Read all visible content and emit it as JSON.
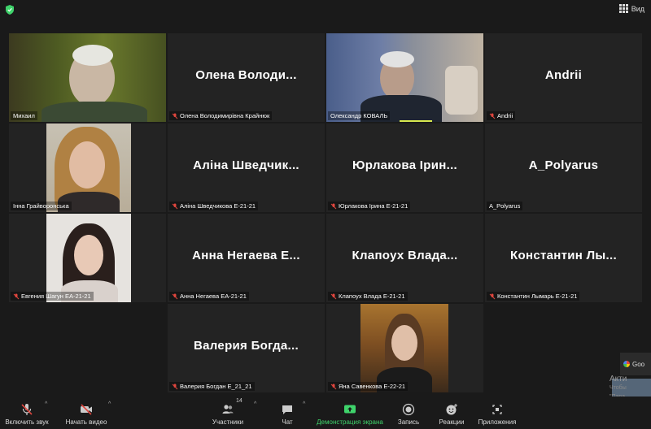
{
  "header": {
    "view_label": "Вид"
  },
  "tiles": [
    {
      "big": "",
      "label": "Михаил",
      "muted": false
    },
    {
      "big": "Олена Володи...",
      "label": "Олена Володимирівна Крайнюк",
      "muted": true
    },
    {
      "big": "",
      "label": "Олександр КОВАЛЬ",
      "muted": false
    },
    {
      "big": "Andrii",
      "label": "Andrii",
      "muted": true
    },
    {
      "big": "",
      "label": "Інна Грайворонська",
      "muted": false
    },
    {
      "big": "Аліна Шведчик...",
      "label": "Аліна Шведчикова Е-21-21",
      "muted": true
    },
    {
      "big": "Юрлакова Ірин...",
      "label": "Юрлакова Ірина Е-21-21",
      "muted": true
    },
    {
      "big": "A_Polyarus",
      "label": "A_Polyarus",
      "muted": false
    },
    {
      "big": "",
      "label": "Евгения Шагун ЕА-21-21",
      "muted": true
    },
    {
      "big": "Анна Негаева Е...",
      "label": "Анна Негаева ЕА-21-21",
      "muted": true
    },
    {
      "big": "Клапоух Влада...",
      "label": "Клапоух Влада Е-21-21",
      "muted": true
    },
    {
      "big": "Константин Лы...",
      "label": "Константин Лымарь Е-21-21",
      "muted": true
    },
    {
      "big": "Валерия Богда...",
      "label": "Валерия Богдан Е_21_21",
      "muted": true
    },
    {
      "big": "",
      "label": "Яна Савенкова Е-22-21",
      "muted": true
    }
  ],
  "toolbar": {
    "mute_label": "Включить звук",
    "video_label": "Начать видео",
    "participants_label": "Участники",
    "participants_count": "14",
    "chat_label": "Чат",
    "share_label": "Демонстрация экрана",
    "record_label": "Запись",
    "reactions_label": "Реакции",
    "apps_label": "Приложения"
  },
  "side": {
    "chip_label": "Goo",
    "activate_title": "Акти",
    "activate_line1": "Чтобы",
    "activate_line2": "\"Пара"
  },
  "colors": {
    "active_border": "#d7e84f",
    "share_green": "#3fd36b",
    "muted_red": "#e0463e",
    "tile_bg": "#232323"
  }
}
